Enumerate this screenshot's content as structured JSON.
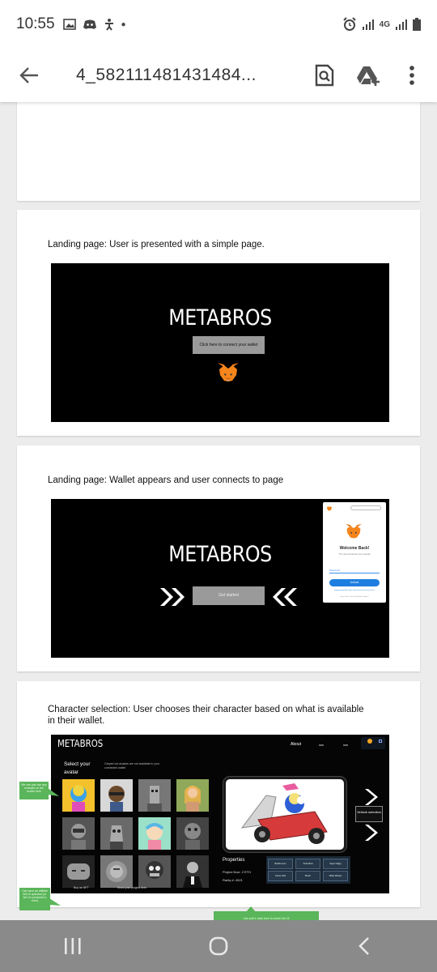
{
  "status_bar": {
    "time": "10:55",
    "network": "4G"
  },
  "app_bar": {
    "title": "4_582111481431484...",
    "icons": [
      "back-arrow-icon",
      "search-document-icon",
      "add-to-drive-icon",
      "more-vert-icon"
    ]
  },
  "slides": [
    {
      "caption": "Landing page: User is presented with a simple page.",
      "brand": "METABROS",
      "button": "Click here to connect your wallet"
    },
    {
      "caption": "Landing page: Wallet appears and user connects to page",
      "brand": "METABROS",
      "button": "Get started",
      "popup": {
        "heading": "Welcome Back!",
        "sub": "The decentralized web awaits",
        "password_label": "Password",
        "unlock": "Unlock",
        "forgot": "Forgot password? Import using Secret Recovery Phrase",
        "help": "Need help? Contact MetaMask Support"
      }
    },
    {
      "caption": "Character selection: User chooses their character based on what is available in their wallet.",
      "brand": "METABROS",
      "nav": [
        "About",
        "xxx",
        "xxx"
      ],
      "select_title": "Select your avatar",
      "greyed_note": "Greyed out avatars are not available in your connected wallet",
      "note_left_top": "We can just use any example on the avatar here",
      "note_left_bottom": "Can have an affiliate link to opensea (or link for products to earn)",
      "buy_nft": "Buy an NFT",
      "show_project": "Show your project here",
      "properties_title": "Properties",
      "project_floor": "Project floor: 2 ETH",
      "rarity": "Rarity #: 4521",
      "property_cells": [
        "Bubble Gum",
        "Turbo Boot",
        "Super Happy",
        "Crown Gold",
        "Brown",
        "White Wheels"
      ],
      "vehicle_selection": "Vehicle selection",
      "bottom_note": "Can pull in data here to enrich the UI"
    }
  ],
  "colors": {
    "slide_bg": "#000000",
    "accent_green": "#5bb55a",
    "unlock_blue": "#1d7ee0",
    "nav_bar": "#8a8a8a"
  }
}
